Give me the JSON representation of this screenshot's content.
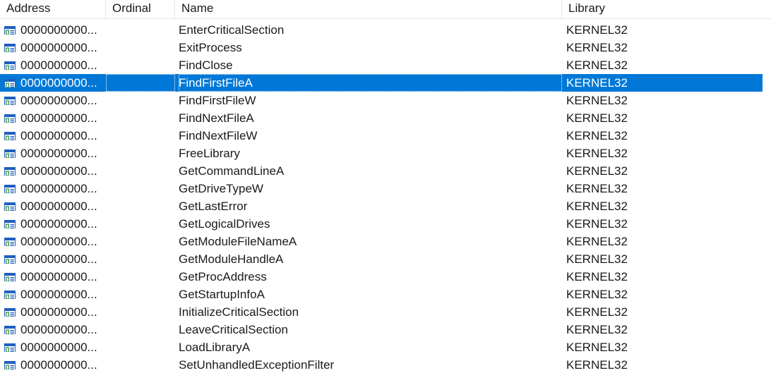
{
  "columns": {
    "address": "Address",
    "ordinal": "Ordinal",
    "name": "Name",
    "library": "Library"
  },
  "icon": "import-function-icon",
  "colors": {
    "selection": "#0078d7",
    "icon_green": "#2e8b3d",
    "icon_blue": "#1f5fbf"
  },
  "rows": [
    {
      "address": "0000000000...",
      "ordinal": "",
      "name": "EnterCriticalSection",
      "library": "KERNEL32",
      "selected": false
    },
    {
      "address": "0000000000...",
      "ordinal": "",
      "name": "ExitProcess",
      "library": "KERNEL32",
      "selected": false
    },
    {
      "address": "0000000000...",
      "ordinal": "",
      "name": "FindClose",
      "library": "KERNEL32",
      "selected": false
    },
    {
      "address": "0000000000...",
      "ordinal": "",
      "name": "FindFirstFileA",
      "library": "KERNEL32",
      "selected": true
    },
    {
      "address": "0000000000...",
      "ordinal": "",
      "name": "FindFirstFileW",
      "library": "KERNEL32",
      "selected": false
    },
    {
      "address": "0000000000...",
      "ordinal": "",
      "name": "FindNextFileA",
      "library": "KERNEL32",
      "selected": false
    },
    {
      "address": "0000000000...",
      "ordinal": "",
      "name": "FindNextFileW",
      "library": "KERNEL32",
      "selected": false
    },
    {
      "address": "0000000000...",
      "ordinal": "",
      "name": "FreeLibrary",
      "library": "KERNEL32",
      "selected": false
    },
    {
      "address": "0000000000...",
      "ordinal": "",
      "name": "GetCommandLineA",
      "library": "KERNEL32",
      "selected": false
    },
    {
      "address": "0000000000...",
      "ordinal": "",
      "name": "GetDriveTypeW",
      "library": "KERNEL32",
      "selected": false
    },
    {
      "address": "0000000000...",
      "ordinal": "",
      "name": "GetLastError",
      "library": "KERNEL32",
      "selected": false
    },
    {
      "address": "0000000000...",
      "ordinal": "",
      "name": "GetLogicalDrives",
      "library": "KERNEL32",
      "selected": false
    },
    {
      "address": "0000000000...",
      "ordinal": "",
      "name": "GetModuleFileNameA",
      "library": "KERNEL32",
      "selected": false
    },
    {
      "address": "0000000000...",
      "ordinal": "",
      "name": "GetModuleHandleA",
      "library": "KERNEL32",
      "selected": false
    },
    {
      "address": "0000000000...",
      "ordinal": "",
      "name": "GetProcAddress",
      "library": "KERNEL32",
      "selected": false
    },
    {
      "address": "0000000000...",
      "ordinal": "",
      "name": "GetStartupInfoA",
      "library": "KERNEL32",
      "selected": false
    },
    {
      "address": "0000000000...",
      "ordinal": "",
      "name": "InitializeCriticalSection",
      "library": "KERNEL32",
      "selected": false
    },
    {
      "address": "0000000000...",
      "ordinal": "",
      "name": "LeaveCriticalSection",
      "library": "KERNEL32",
      "selected": false
    },
    {
      "address": "0000000000...",
      "ordinal": "",
      "name": "LoadLibraryA",
      "library": "KERNEL32",
      "selected": false
    },
    {
      "address": "0000000000...",
      "ordinal": "",
      "name": "SetUnhandledExceptionFilter",
      "library": "KERNEL32",
      "selected": false
    }
  ]
}
